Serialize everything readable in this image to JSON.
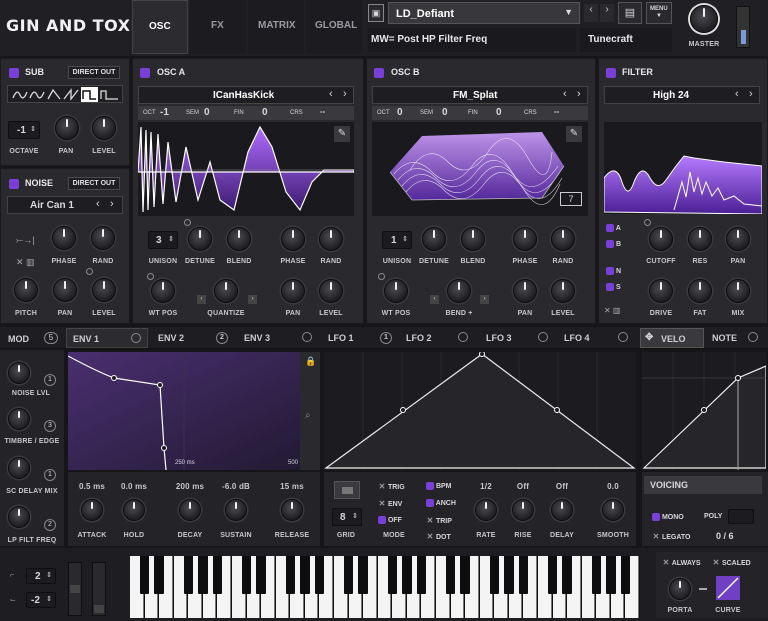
{
  "header": {
    "logo": "GIN AND TOXIC",
    "tabs": [
      "OSC",
      "FX",
      "MATRIX",
      "GLOBAL"
    ],
    "preset": "LD_Defiant",
    "mw_text": "MW= Post HP Filter Freq",
    "author": "Tunecraft",
    "menu": "MENU",
    "master": "MASTER"
  },
  "sub": {
    "title": "SUB",
    "direct_out": "DIRECT OUT",
    "octave_value": "-1",
    "labels": [
      "OCTAVE",
      "PAN",
      "LEVEL"
    ]
  },
  "noise": {
    "title": "NOISE",
    "direct_out": "DIRECT OUT",
    "preset": "Air Can 1",
    "labels": [
      "PHASE",
      "RAND",
      "PITCH",
      "PAN",
      "LEVEL"
    ]
  },
  "osc_a": {
    "title": "OSC A",
    "preset": "ICanHasKick",
    "oct": "OCT",
    "oct_val": "-1",
    "sem": "SEM",
    "sem_val": "0",
    "fin": "FIN",
    "fin_val": "0",
    "crs": "CRS",
    "crs_val": "--",
    "unison": "3",
    "labels": [
      "UNISON",
      "DETUNE",
      "BLEND",
      "PHASE",
      "RAND",
      "WT POS",
      "QUANTIZE",
      "PAN",
      "LEVEL"
    ]
  },
  "osc_b": {
    "title": "OSC B",
    "preset": "FM_Splat",
    "oct": "OCT",
    "oct_val": "0",
    "sem": "SEM",
    "sem_val": "0",
    "fin": "FIN",
    "fin_val": "0",
    "crs": "CRS",
    "crs_val": "--",
    "unison": "1",
    "frame": "7",
    "labels": [
      "UNISON",
      "DETUNE",
      "BLEND",
      "PHASE",
      "RAND",
      "WT POS",
      "BEND +",
      "PAN",
      "LEVEL"
    ]
  },
  "filter": {
    "title": "FILTER",
    "type": "High 24",
    "routes": [
      "A",
      "B",
      "N",
      "S"
    ],
    "labels": [
      "CUTOFF",
      "RES",
      "PAN",
      "DRIVE",
      "FAT",
      "MIX"
    ]
  },
  "mod": {
    "title": "MOD",
    "count": "5",
    "tabs": [
      {
        "label": "ENV 1",
        "n": ""
      },
      {
        "label": "ENV 2",
        "n": "2"
      },
      {
        "label": "ENV 3",
        "n": ""
      },
      {
        "label": "LFO 1",
        "n": "1"
      },
      {
        "label": "LFO 2",
        "n": ""
      },
      {
        "label": "LFO 3",
        "n": ""
      },
      {
        "label": "LFO 4",
        "n": ""
      },
      {
        "label": "VELO",
        "n": ""
      },
      {
        "label": "NOTE",
        "n": ""
      }
    ],
    "slots": [
      {
        "label": "NOISE LVL",
        "n": "1"
      },
      {
        "label": "TIMBRE / EDGE",
        "n": "3"
      },
      {
        "label": "SC DELAY MIX",
        "n": "1"
      },
      {
        "label": "LP FILT FREQ",
        "n": "2"
      }
    ]
  },
  "env": {
    "time_mark": "250 ms",
    "time_mark2": "500",
    "values": [
      "0.5 ms",
      "0.0 ms",
      "200 ms",
      "-6.0 dB",
      "15 ms"
    ],
    "labels": [
      "ATTACK",
      "HOLD",
      "DECAY",
      "SUSTAIN",
      "RELEASE"
    ]
  },
  "lfo": {
    "grid": "8",
    "grid_label": "GRID",
    "mode_label": "MODE",
    "modes": [
      "TRIG",
      "ENV",
      "OFF"
    ],
    "opts": [
      "BPM",
      "ANCH",
      "TRIP",
      "DOT"
    ],
    "values": [
      "1/2",
      "Off",
      "Off",
      "0.0"
    ],
    "labels": [
      "RATE",
      "RISE",
      "DELAY",
      "SMOOTH"
    ]
  },
  "voicing": {
    "title": "VOICING",
    "mono": "MONO",
    "poly": "POLY",
    "legato": "LEGATO",
    "voices": "0 / 6"
  },
  "kb": {
    "pitch_up": "2",
    "pitch_down": "-2",
    "always": "ALWAYS",
    "scaled": "SCALED",
    "porta": "PORTA",
    "curve": "CURVE"
  },
  "colors": {
    "accent": "#7a3fd8",
    "bg": "#16161a",
    "panel": "#2a2a2e"
  }
}
